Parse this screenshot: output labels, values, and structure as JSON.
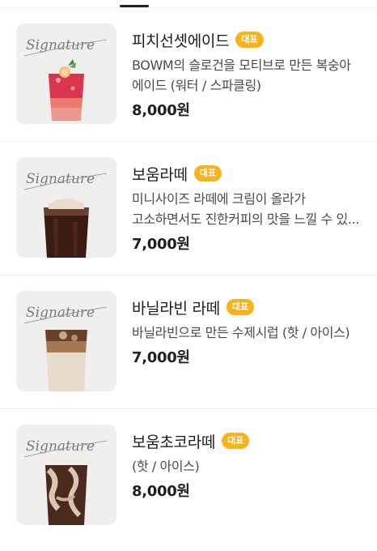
{
  "items": [
    {
      "name": "피치선셋에이드",
      "badge": "대표",
      "description": "BOWM의 슬로건을 모티브로 만든 복숭아 에이드 (워터 / 스파클링)",
      "price": "8,000원",
      "thumb_label": "Signature",
      "drink": "peach-sunset-ade"
    },
    {
      "name": "보움라떼",
      "badge": "대표",
      "description": "미니사이즈 라떼에 크림이 올라가 고소하면서도 진한커피의 맛을 느낄 수 있...",
      "price": "7,000원",
      "thumb_label": "Signature",
      "drink": "bowm-latte"
    },
    {
      "name": "바닐라빈 라떼",
      "badge": "대표",
      "description": "바닐라빈으로 만든 수제시럽 (핫 / 아이스)",
      "price": "7,000원",
      "thumb_label": "Signature",
      "drink": "vanilla-bean-latte"
    },
    {
      "name": "보움초코라떼",
      "badge": "대표",
      "description": "(핫 / 아이스)",
      "price": "8,000원",
      "thumb_label": "Signature",
      "drink": "bowm-choco-latte"
    }
  ],
  "colors": {
    "badge": "#f7b21d",
    "thumb_bg": "#f1efee",
    "divider": "#ededed"
  }
}
